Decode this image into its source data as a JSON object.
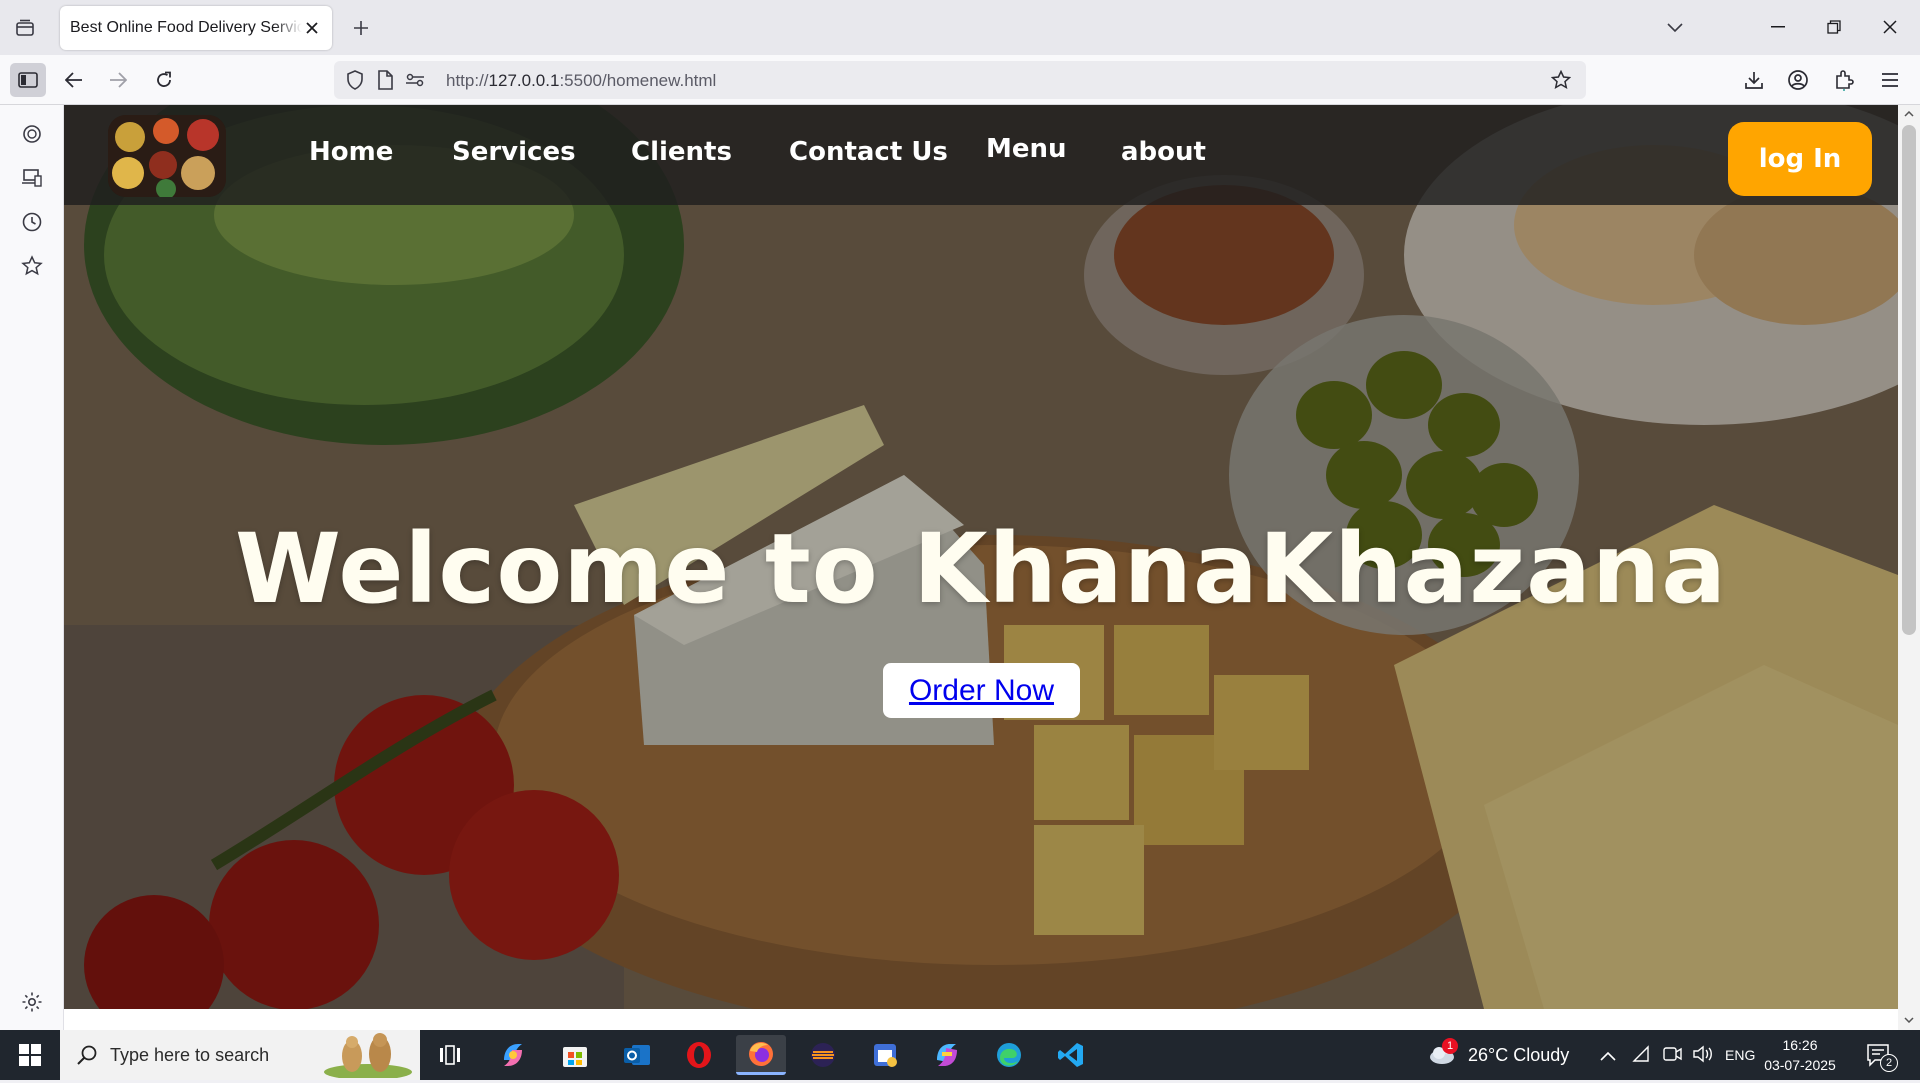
{
  "browser": {
    "tab_title": "Best Online Food Delivery Service in",
    "url_prefix": "http://",
    "url_host": "127.0.0.1",
    "url_rest": ":5500/homenew.html"
  },
  "site": {
    "nav": [
      "Home",
      "Services",
      "Clients",
      "Contact Us",
      "Menu",
      "about"
    ],
    "login_label": "log In",
    "hero_title": "Welcome to KhanaKhazana",
    "order_label": "Order Now"
  },
  "taskbar": {
    "search_placeholder": "Type here to search",
    "weather": "26°C  Cloudy",
    "weather_badge": "1",
    "language": "ENG",
    "time": "16:26",
    "date": "03-07-2025",
    "notification_count": "2"
  },
  "colors": {
    "login_button": "#ffa500",
    "order_link": "#0000ee",
    "header_bg": "#1e1e1e"
  }
}
